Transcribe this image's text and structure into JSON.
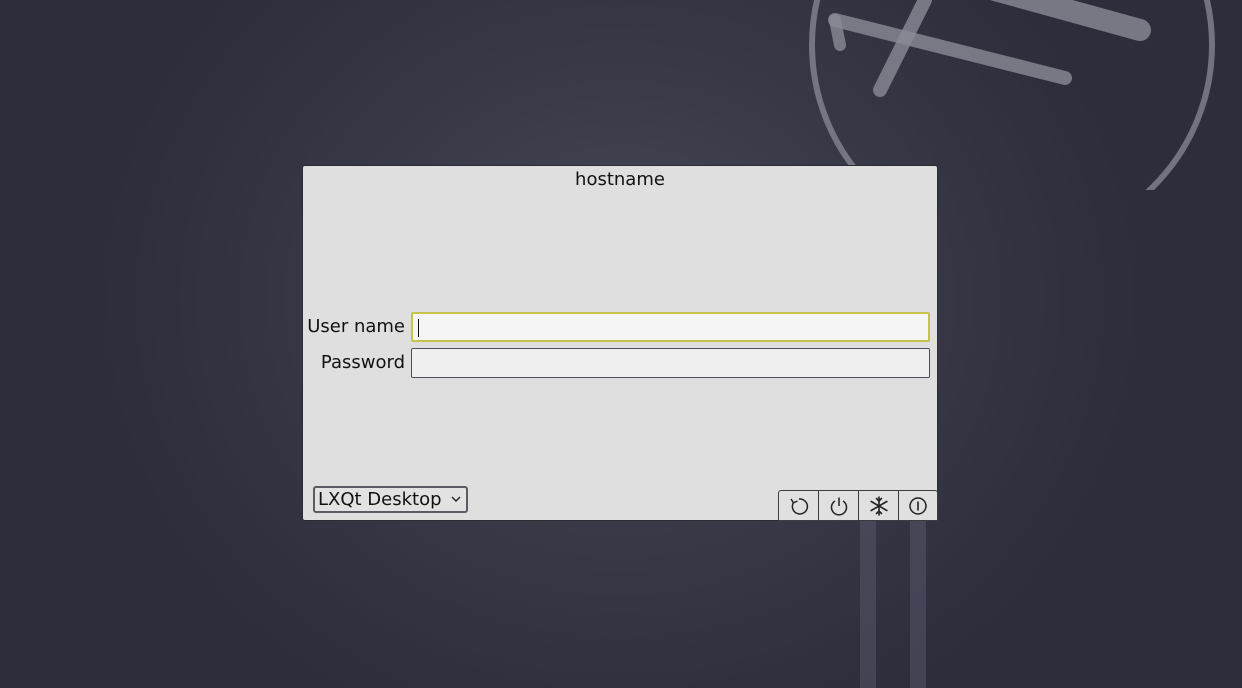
{
  "window": {
    "hostname": "hostname"
  },
  "form": {
    "username_label": "User name",
    "username_value": "",
    "password_label": "Password",
    "password_value": ""
  },
  "session": {
    "selected": "LXQt Desktop"
  },
  "power_actions": [
    {
      "name": "reboot",
      "icon": "reboot-icon"
    },
    {
      "name": "shutdown",
      "icon": "power-icon"
    },
    {
      "name": "hibernate",
      "icon": "snowflake-icon"
    },
    {
      "name": "suspend",
      "icon": "suspend-icon"
    }
  ],
  "colors": {
    "background": "#2d2d3b",
    "panel": "#dfdfe0",
    "focus_border": "#c6c34a"
  }
}
